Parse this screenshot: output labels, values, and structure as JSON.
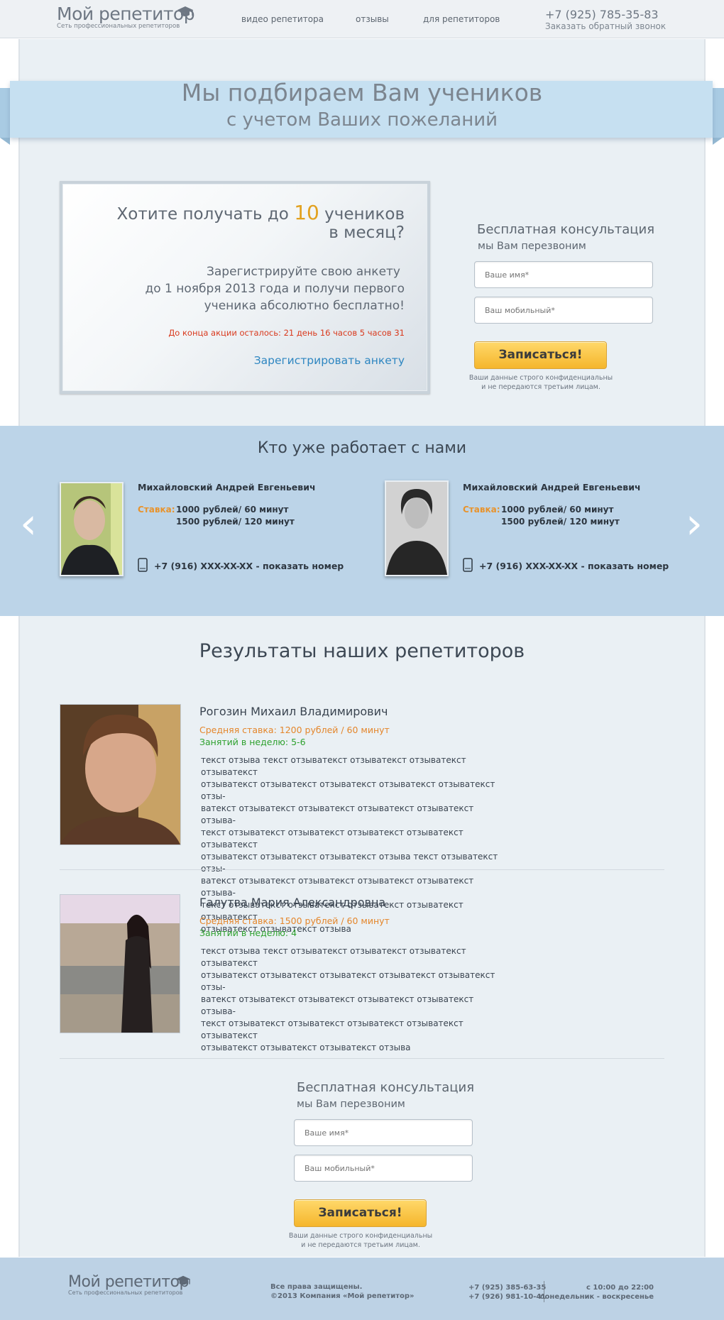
{
  "header": {
    "logo_title": "Мой репетитор",
    "logo_subtitle": "Сеть профессиональных репетиторов",
    "nav": [
      "видео репетитора",
      "отзывы",
      "для репетиторов"
    ],
    "phone": "+7 (925) 785-35-83",
    "callback": "Заказать обратный звонок"
  },
  "hero": {
    "line1": "Мы подбираем Вам учеников",
    "line2": "с учетом Ваших пожеланий"
  },
  "promo": {
    "headline_before": "Хотите получать до",
    "headline_number": "10",
    "headline_after": "учеников",
    "headline_line2": "в месяц?",
    "body_line1": "Зарегистрируйте свою анкету",
    "body_line2": "до 1 ноября 2013 года и получи первого",
    "body_line3": "ученика абсолютно бесплатно!",
    "countdown": "До конца акции осталось: 21 день 16 часов 5 часов 31",
    "register_link": "Зарегистрировать анкету"
  },
  "consult": {
    "title": "Бесплатная консультация",
    "subtitle": "мы Вам перезвоним",
    "name_placeholder": "Ваше имя*",
    "phone_placeholder": "Ваш мобильный*",
    "button": "Записаться!",
    "note_line1": "Ваши данные строго конфиденциальны",
    "note_line2": "и не передаются третьим лицам."
  },
  "tutors": {
    "title": "Кто уже работает с нами",
    "items": [
      {
        "name": "Михайловский Андрей Евгеньевич",
        "rate_label": "Ставка:",
        "rate1": "1000 рублей/ 60 минут",
        "rate2": "1500 рублей/ 120 минут",
        "phone": "+7 (916) XXX-XX-XX - показать номер"
      },
      {
        "name": "Михайловский Андрей Евгеньевич",
        "rate_label": "Ставка:",
        "rate1": "1000 рублей/ 60 минут",
        "rate2": "1500 рублей/ 120 минут",
        "phone": "+7 (916) XXX-XX-XX - показать номер"
      }
    ],
    "prev_icon": "chevron-left-icon",
    "next_icon": "chevron-right-icon"
  },
  "results": {
    "title": "Результаты наших репетиторов",
    "items": [
      {
        "name": "Рогозин Михаил Владимирович",
        "rate": "Средняя ставка: 1200 рублей / 60 минут",
        "lessons": "Занятий в неделю: 5-6",
        "lines": [
          "текст отзыва текст отзыватекст отзыватекст отзыватекст отзыватекст",
          "отзыватекст отзыватекст отзыватекст отзыватекст отзыватекст отзы-",
          "ватекст отзыватекст отзыватекст отзыватекст отзыватекст отзыва-",
          "текст отзыватекст отзыватекст отзыватекст отзыватекст отзыватекст",
          "отзыватекст отзыватекст отзыватекст отзыва текст отзыватекст отзы-",
          "ватекст отзыватекст отзыватекст отзыватекст отзыватекст отзыва-",
          "текст отзыватекст отзыватекст отзыватекст отзыватекст отзыватекст",
          "отзыватекст отзыватекст отзыва"
        ]
      },
      {
        "name": "Галутва Мария Александровна",
        "rate": "Средняя ставка: 1500 рублей / 60 минут",
        "lessons": "Занятий в неделю: 4",
        "lines": [
          "текст отзыва текст отзыватекст отзыватекст отзыватекст отзыватекст",
          "отзыватекст отзыватекст отзыватекст отзыватекст отзыватекст отзы-",
          "ватекст отзыватекст отзыватекст отзыватекст отзыватекст отзыва-",
          "текст отзыватекст отзыватекст отзыватекст отзыватекст отзыватекст",
          "отзыватекст отзыватекст отзыватекст отзыва"
        ]
      }
    ]
  },
  "footer": {
    "logo_title": "Мой репетитор",
    "logo_subtitle": "Сеть профессиональных репетиторов",
    "rights": "Все права защищены.",
    "copyright": "©2013  Компания «Мой репетитор»",
    "phone1": "+7 (925) 385-63-35",
    "phone2": "+7 (926) 981-10-41",
    "hours": "с 10:00 до 22:00",
    "days": "понедельник - воскресенье"
  },
  "colors": {
    "hero_banner": "#c6e0f1",
    "band": "#bcd4e8",
    "button": "#f5b62c",
    "orange": "#e4862b",
    "green": "#2ea12e",
    "link_blue": "#2e86c1",
    "countdown_red": "#d93a1e"
  }
}
